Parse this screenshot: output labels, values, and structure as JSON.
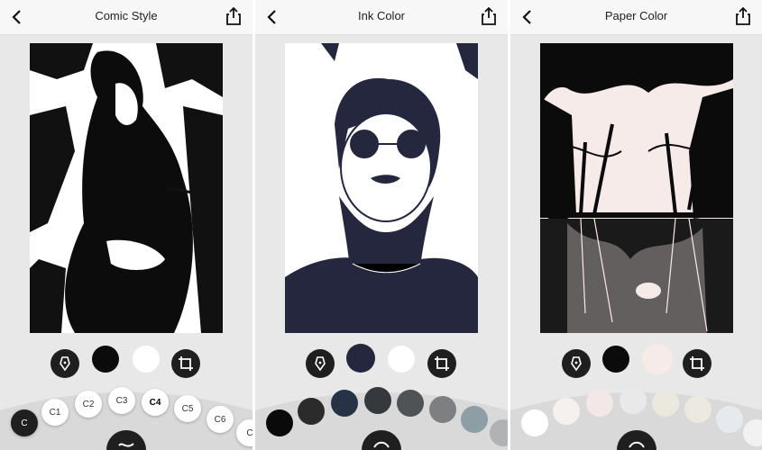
{
  "panels": [
    {
      "title": "Comic Style",
      "chips": [
        "C1",
        "C2",
        "C3",
        "C4",
        "C5",
        "C6",
        "C"
      ],
      "selected_chip": "C4",
      "colors": {
        "ink": "#0b0b0b",
        "paper": "#ffffff"
      }
    },
    {
      "title": "Ink Color",
      "colors": {
        "ink": "#25273f",
        "paper": "#ffffff"
      },
      "palette": [
        "#0a0a0a",
        "#2b2b2b",
        "#283247",
        "#35393e",
        "#4f5356",
        "#7d7f80",
        "#8e9ea5",
        "#b0b2b4"
      ]
    },
    {
      "title": "Paper Color",
      "colors": {
        "ink": "#0b0b0b",
        "paper": "#f7ebea"
      },
      "palette": [
        "#ffffff",
        "#f4f1ee",
        "#f2e9e6",
        "#eae9ea",
        "#eae8df",
        "#eceae0",
        "#e6eaee",
        "#f2f2f2"
      ]
    }
  ],
  "icons": {
    "back": "back-chevron-icon",
    "share": "share-icon",
    "pen": "pen-nib-icon",
    "crop": "crop-icon",
    "wave": "wave-icon"
  }
}
